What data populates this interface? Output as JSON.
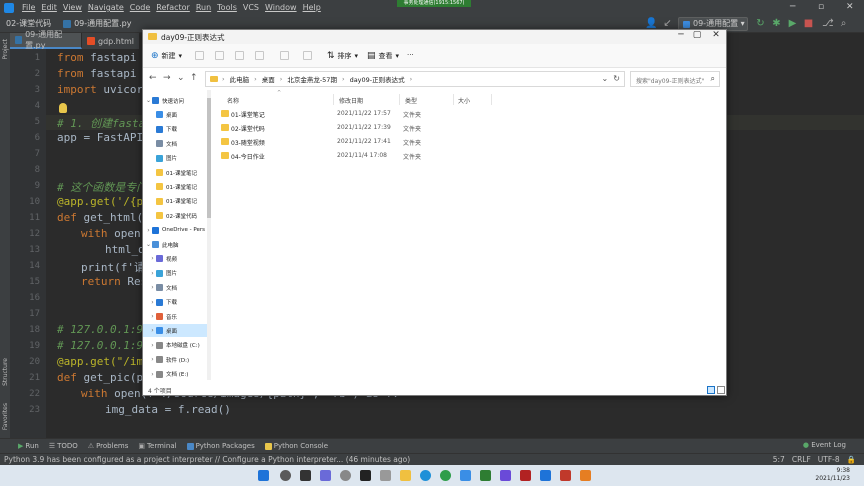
{
  "ide": {
    "menu": [
      "File",
      "Edit",
      "View",
      "Navigate",
      "Code",
      "Refactor",
      "Run",
      "Tools",
      "VCS",
      "Window",
      "Help"
    ],
    "recording_banner": "事务处理通信(1915:1567)",
    "breadcrumb_project": "02-课堂代码",
    "breadcrumb_file": "09-通用配置.py",
    "run_config": "09-通用配置",
    "tabs": [
      "09-通用配置.py",
      "gdp.html"
    ],
    "left_strip": [
      "Project",
      "Structure",
      "Favorites"
    ],
    "line_numbers": [
      "1",
      "2",
      "3",
      "4",
      "5",
      "6",
      "7",
      "8",
      "9",
      "10",
      "11",
      "12",
      "13",
      "14",
      "15",
      "16",
      "17",
      "18",
      "19",
      "20",
      "21",
      "22",
      "23"
    ],
    "code": {
      "l1_kw": "from",
      "l1_rest": " fastapi in",
      "l2_kw": "from",
      "l2_rest": " fastapi in",
      "l3_kw": "import",
      "l3_rest": " uvicorn",
      "l5": "# 1. 创建fastap",
      "l6": "app = FastAPI(",
      "l9": "# 这个函数是专门",
      "l10": "@app.get('/{pat",
      "l11_kw": "def",
      "l11_rest": " get_html(pa",
      "l12_kw": "with",
      "l12_rest": " open(f",
      "l13": "html_da",
      "l14": "print(f'请",
      "l15_kw": "return",
      "l15_rest": " Resp",
      "l18": "# 127.0.0.1:900",
      "l19": "# 127.0.0.1:900",
      "l20": "@app.get(\"/imag",
      "l21_kw": "def",
      "l21_rest": " get_pic(pat",
      "l22_kw": "with",
      "l22_rest": " open(f\"./source/images/{path}\", \"rb\") as f:",
      "l23": "img_data = f.read()"
    },
    "tool_tabs": [
      "Run",
      "TODO",
      "Problems",
      "Terminal",
      "Python Packages",
      "Python Console"
    ],
    "event_log": "Event Log",
    "status_message": "Python 3.9 has been configured as a project interpreter // Configure a Python interpreter... (46 minutes ago)",
    "status_right": [
      "5:7",
      "CRLF",
      "UTF-8"
    ]
  },
  "explorer": {
    "title": "day09-正则表达式",
    "commands": {
      "new": "新建",
      "sort": "排序",
      "view": "查看",
      "more": "···"
    },
    "address": [
      "此电脑",
      "桌面",
      "北京金燕龙-57期",
      "day09-正则表达式"
    ],
    "search_placeholder": "搜索\"day09-正则表达式\"",
    "columns": {
      "name": "名称",
      "date": "修改日期",
      "type": "类型",
      "size": "大小"
    },
    "nav": [
      {
        "label": "快速访问",
        "expand": "v",
        "color": "#2a7ad5"
      },
      {
        "label": "桌面",
        "color": "#3a8ee6"
      },
      {
        "label": "下载",
        "color": "#2a7ad5"
      },
      {
        "label": "文档",
        "color": "#7a8da4"
      },
      {
        "label": "图片",
        "color": "#3aa3d8"
      },
      {
        "label": "01-课堂笔记",
        "color": "#f4c542"
      },
      {
        "label": "01-课堂笔记",
        "color": "#f4c542"
      },
      {
        "label": "01-课堂笔记",
        "color": "#f4c542"
      },
      {
        "label": "02-课堂代码",
        "color": "#f4c542"
      },
      {
        "label": "OneDrive - Pers",
        "expand": ">",
        "color": "#1e73d8"
      },
      {
        "label": "此电脑",
        "expand": "v",
        "color": "#4a90d9"
      },
      {
        "label": "视频",
        "expand": ">",
        "color": "#6a6ad8"
      },
      {
        "label": "图片",
        "expand": ">",
        "color": "#3aa3d8"
      },
      {
        "label": "文档",
        "expand": ">",
        "color": "#7a8da4"
      },
      {
        "label": "下载",
        "expand": ">",
        "color": "#2a7ad5"
      },
      {
        "label": "音乐",
        "expand": ">",
        "color": "#e0603a"
      },
      {
        "label": "桌面",
        "expand": ">",
        "color": "#3a8ee6"
      },
      {
        "label": "本地磁盘 (C:)",
        "expand": ">",
        "color": "#888888"
      },
      {
        "label": "软件 (D:)",
        "expand": ">",
        "color": "#888888"
      },
      {
        "label": "文档 (E:)",
        "expand": ">",
        "color": "#888888"
      }
    ],
    "files": [
      {
        "name": "01-课堂笔记",
        "date": "2021/11/22 17:57",
        "type": "文件夹"
      },
      {
        "name": "02-课堂代码",
        "date": "2021/11/22 17:39",
        "type": "文件夹"
      },
      {
        "name": "03-随堂视频",
        "date": "2021/11/22 17:41",
        "type": "文件夹"
      },
      {
        "name": "04-今日作业",
        "date": "2021/11/4 17:08",
        "type": "文件夹"
      }
    ],
    "status": "4 个项目"
  },
  "taskbar": {
    "time": "9:38",
    "date": "2021/11/23"
  }
}
